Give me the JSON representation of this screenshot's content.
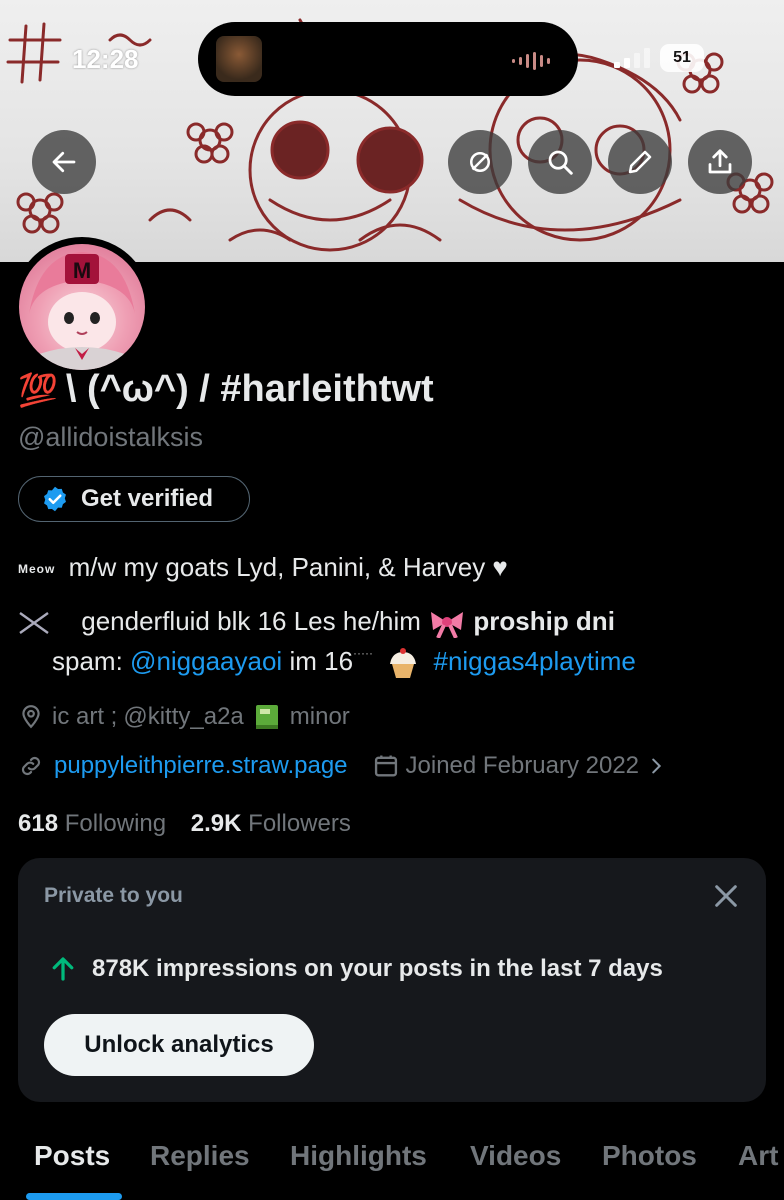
{
  "status_bar": {
    "time": "12:28",
    "battery": "51"
  },
  "profile": {
    "display_name": "\\ (^ω^) /  #harleithtwt",
    "name_emoji": "💯",
    "handle": "@allidoistalksis",
    "get_verified_label": "Get verified",
    "bio_line1_prefix": "Meow",
    "bio_line1": "m/w my goats Lyd, Panini, & Harvey ♥",
    "bio_line2_a": "genderfluid blk 16 Les he/him",
    "bio_line2_b": "proship dni",
    "bio_line3_a": "spam:",
    "bio_line3_mention": "@niggaayaoi",
    "bio_line3_b": "im 16",
    "bio_line3_tag": "#niggas4playtime",
    "location_a": "ic art ;",
    "location_b": "@kitty_a2a",
    "location_c": "minor",
    "website": "puppyleithpierre.straw.page",
    "joined": "Joined February 2022",
    "following_count": "618",
    "following_label": "Following",
    "followers_count": "2.9K",
    "followers_label": "Followers"
  },
  "analytics_card": {
    "private_label": "Private to you",
    "impressions_text": "878K impressions on your posts in the last 7 days",
    "unlock_label": "Unlock analytics"
  },
  "tabs": [
    {
      "label": "Posts",
      "active": true
    },
    {
      "label": "Replies"
    },
    {
      "label": "Highlights"
    },
    {
      "label": "Videos"
    },
    {
      "label": "Photos"
    },
    {
      "label": "Art"
    }
  ],
  "colors": {
    "accent": "#1d9bf0",
    "text_primary": "#e7e9ea",
    "text_secondary": "#71767b",
    "card_bg": "#16181c",
    "up_arrow": "#00ba7c"
  },
  "icons": [
    "back-arrow-icon",
    "repost-icon",
    "search-icon",
    "edit-icon",
    "share-icon",
    "verified-badge-icon",
    "location-icon",
    "link-icon",
    "calendar-icon",
    "chevron-right-icon",
    "close-icon",
    "up-arrow-icon"
  ]
}
